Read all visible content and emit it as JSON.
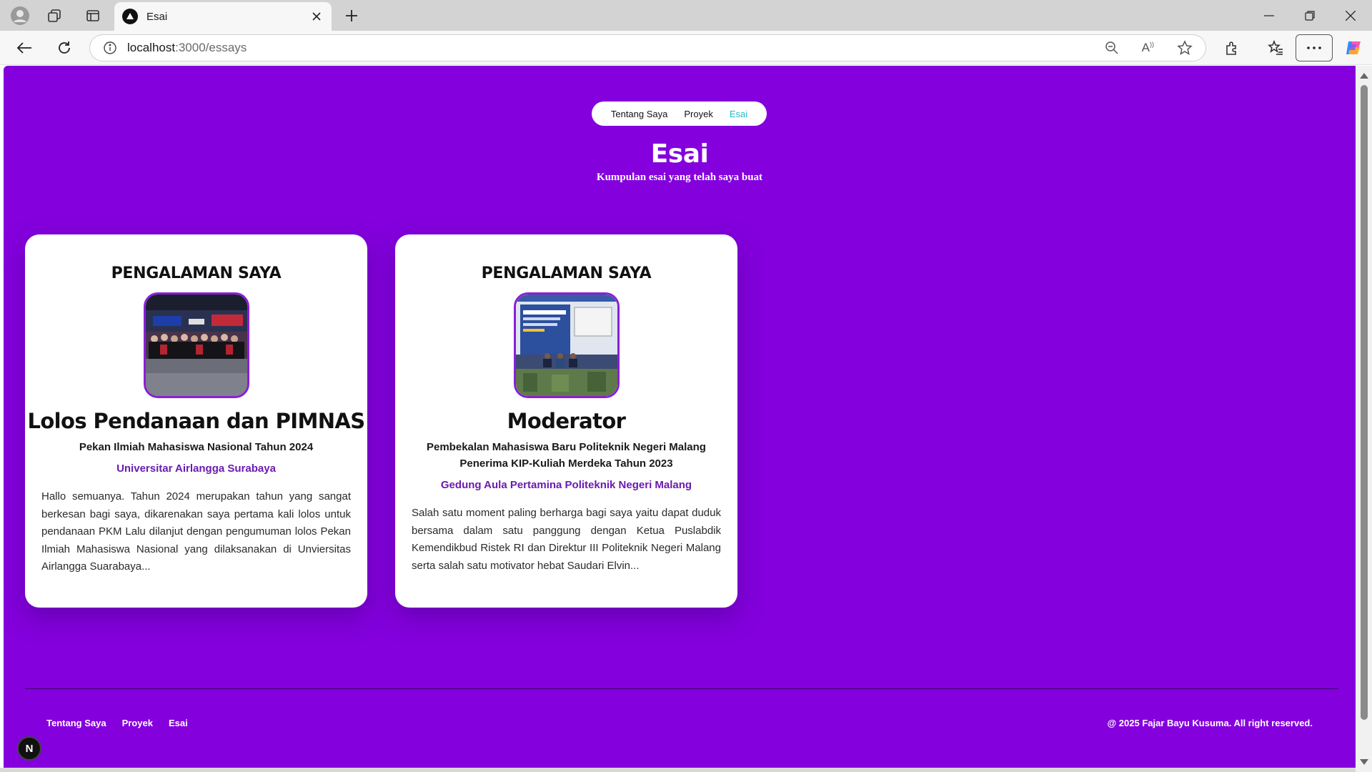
{
  "browser": {
    "tab_title": "Esai",
    "url_host": "localhost",
    "url_path": ":3000/essays"
  },
  "nav": {
    "items": [
      "Tentang Saya",
      "Proyek",
      "Esai"
    ],
    "active": "Esai"
  },
  "header": {
    "title": "Esai",
    "subtitle": "Kumpulan esai yang telah saya buat"
  },
  "cards": [
    {
      "eyebrow": "PENGALAMAN SAYA",
      "photo": "group-photo",
      "title": "Lolos Pendanaan dan PIMNAS",
      "event": "Pekan Ilmiah Mahasiswa Nasional Tahun 2024",
      "place": "Universitar Airlangga Surabaya",
      "body": "Hallo semuanya. Tahun 2024 merupakan tahun yang sangat berkesan bagi saya, dikarenakan saya pertama kali lolos untuk pendanaan PKM Lalu dilanjut dengan pengumuman lolos Pekan Ilmiah Mahasiswa Nasional yang dilaksanakan di Unviersitas Airlangga Suarabaya..."
    },
    {
      "eyebrow": "PENGALAMAN SAYA",
      "photo": "stage-photo",
      "title": "Moderator",
      "event": "Pembekalan Mahasiswa Baru Politeknik Negeri Malang Penerima KIP-Kuliah Merdeka Tahun 2023",
      "place": "Gedung Aula Pertamina Politeknik Negeri Malang",
      "body": "Salah satu moment paling berharga bagi saya yaitu dapat duduk bersama dalam satu panggung dengan Ketua Puslabdik Kemendikbud Ristek RI dan Direktur III Politeknik Negeri Malang serta salah satu motivator hebat Saudari Elvin..."
    }
  ],
  "footer": {
    "links": [
      "Tentang Saya",
      "Proyek",
      "Esai"
    ],
    "copyright": "@ 2025 Fajar Bayu Kusuma. All right reserved."
  },
  "dev_badge": "N",
  "colors": {
    "page_bg": "#8400dd",
    "accent_link": "#27b8c7",
    "place_text": "#6a1bb0",
    "photo_border": "#8a1fd6"
  }
}
